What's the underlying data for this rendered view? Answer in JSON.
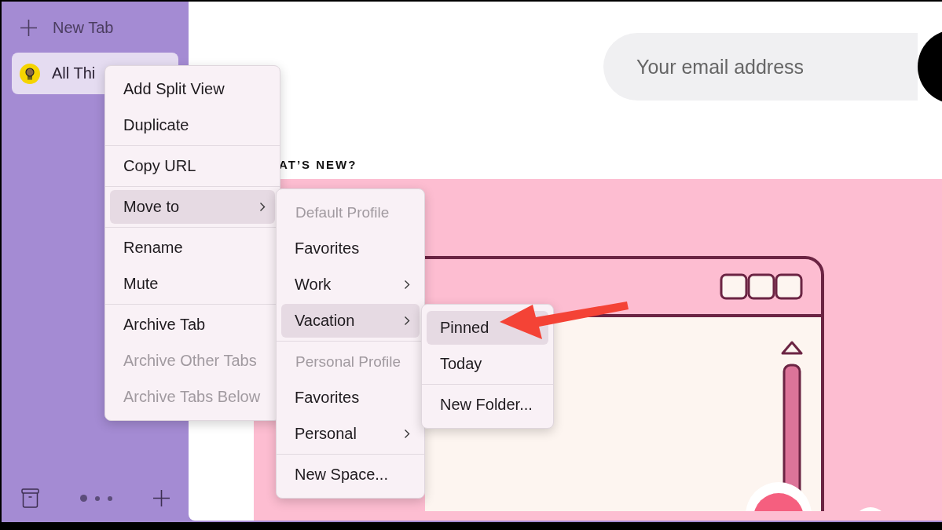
{
  "sidebar": {
    "new_tab": {
      "label": "New Tab"
    },
    "tabs": [
      {
        "label": "All Thi",
        "selected": true
      }
    ],
    "page_dots": [
      {
        "selected": true
      },
      {
        "selected": false
      },
      {
        "selected": false
      }
    ]
  },
  "page": {
    "email_field": {
      "placeholder": "Your email address"
    },
    "heading": "AT’S NEW?"
  },
  "context_menu": {
    "sections": [
      {
        "items": [
          {
            "label": "Add Split View",
            "kind": "item",
            "highlighted": false,
            "disabled": false,
            "submenu": false
          },
          {
            "label": "Duplicate",
            "kind": "item",
            "highlighted": false,
            "disabled": false,
            "submenu": false
          }
        ]
      },
      {
        "items": [
          {
            "label": "Copy URL",
            "kind": "item",
            "highlighted": false,
            "disabled": false,
            "submenu": false
          }
        ]
      },
      {
        "items": [
          {
            "label": "Move to",
            "kind": "item",
            "highlighted": true,
            "disabled": false,
            "submenu": true
          }
        ]
      },
      {
        "items": [
          {
            "label": "Rename",
            "kind": "item",
            "highlighted": false,
            "disabled": false,
            "submenu": false
          },
          {
            "label": "Mute",
            "kind": "item",
            "highlighted": false,
            "disabled": false,
            "submenu": false
          }
        ]
      },
      {
        "items": [
          {
            "label": "Archive Tab",
            "kind": "item",
            "highlighted": false,
            "disabled": false,
            "submenu": false
          },
          {
            "label": "Archive Other Tabs",
            "kind": "item",
            "highlighted": false,
            "disabled": true,
            "submenu": false
          },
          {
            "label": "Archive Tabs Below",
            "kind": "item",
            "highlighted": false,
            "disabled": true,
            "submenu": false
          }
        ]
      }
    ]
  },
  "move_to_menu": {
    "sections": [
      {
        "items": [
          {
            "label": "Default Profile",
            "kind": "header",
            "highlighted": false,
            "disabled": true,
            "submenu": false
          },
          {
            "label": "Favorites",
            "kind": "item",
            "highlighted": false,
            "disabled": false,
            "submenu": false
          },
          {
            "label": "Work",
            "kind": "item",
            "highlighted": false,
            "disabled": false,
            "submenu": true
          },
          {
            "label": "Vacation",
            "kind": "item",
            "highlighted": true,
            "disabled": false,
            "submenu": true
          }
        ]
      },
      {
        "items": [
          {
            "label": "Personal Profile",
            "kind": "header",
            "highlighted": false,
            "disabled": true,
            "submenu": false
          },
          {
            "label": "Favorites",
            "kind": "item",
            "highlighted": false,
            "disabled": false,
            "submenu": false
          },
          {
            "label": "Personal",
            "kind": "item",
            "highlighted": false,
            "disabled": false,
            "submenu": true
          }
        ]
      },
      {
        "items": [
          {
            "label": "New Space...",
            "kind": "item",
            "highlighted": false,
            "disabled": false,
            "submenu": false
          }
        ]
      }
    ]
  },
  "vacation_menu": {
    "sections": [
      {
        "items": [
          {
            "label": "Pinned",
            "kind": "item",
            "highlighted": true,
            "disabled": false,
            "submenu": false
          },
          {
            "label": "Today",
            "kind": "item",
            "highlighted": false,
            "disabled": false,
            "submenu": false
          }
        ]
      },
      {
        "items": [
          {
            "label": "New Folder...",
            "kind": "item",
            "highlighted": false,
            "disabled": false,
            "submenu": false
          }
        ]
      }
    ]
  }
}
